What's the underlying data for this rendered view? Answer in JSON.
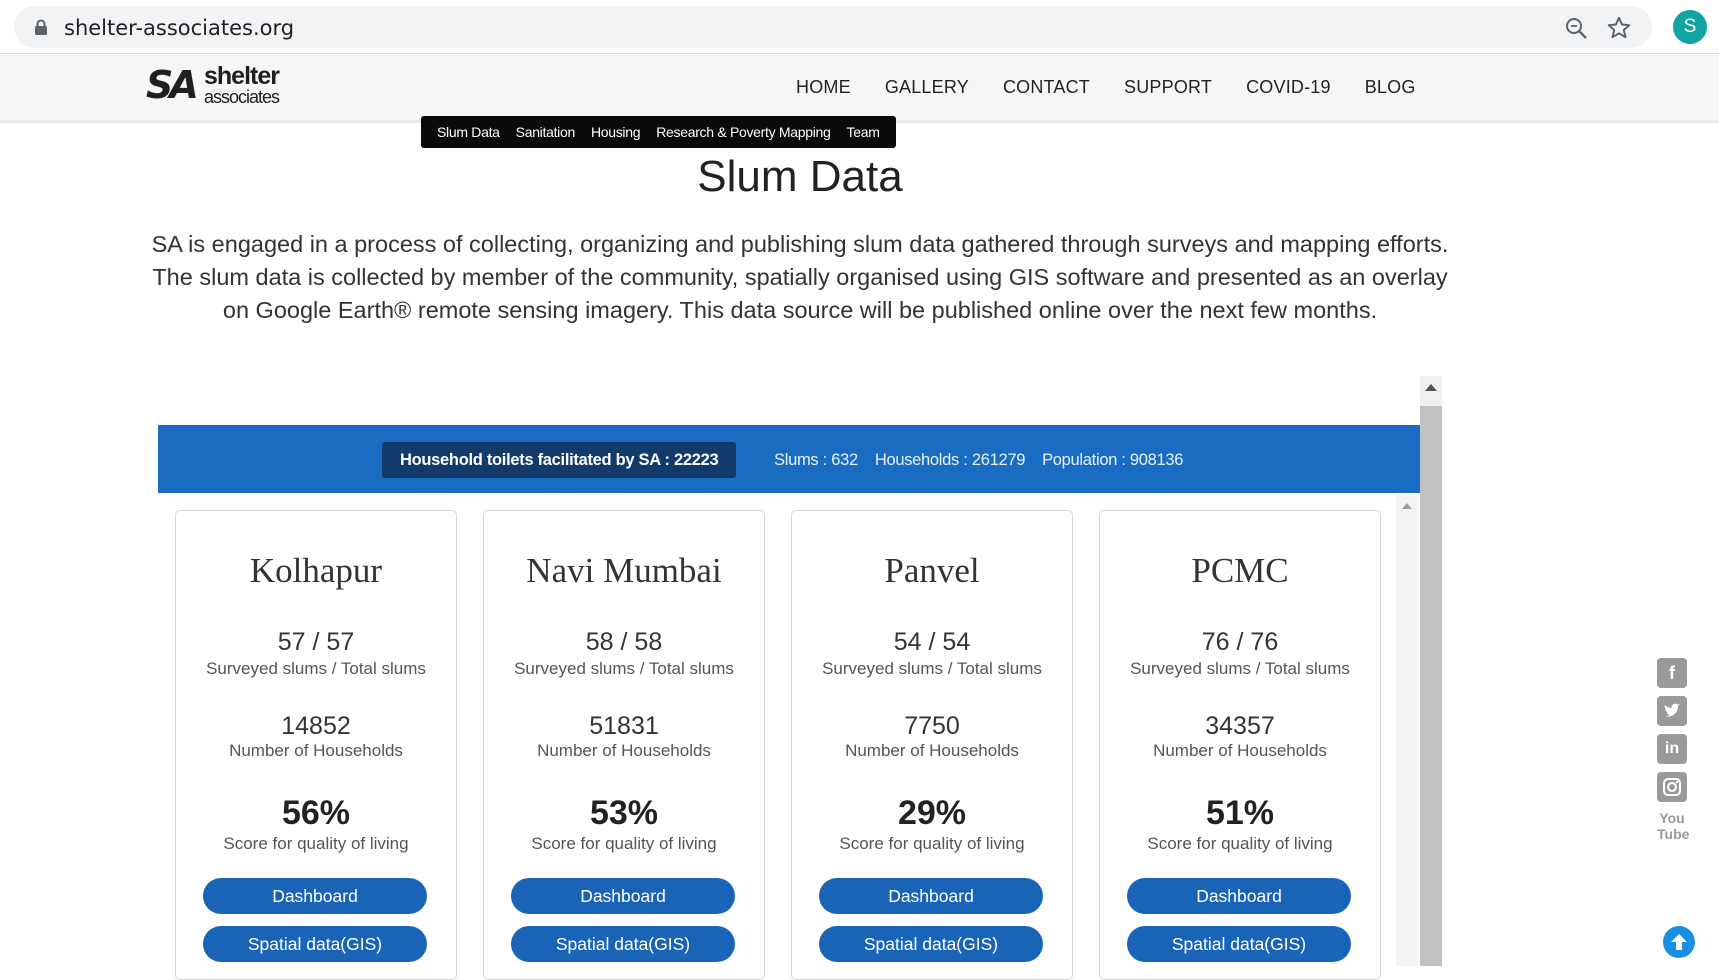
{
  "browser": {
    "url": "shelter-associates.org",
    "profile_initial": "S"
  },
  "header": {
    "logo": {
      "mark": "SA",
      "word1": "shelter",
      "word2": "associates"
    },
    "nav": [
      "HOME",
      "GALLERY",
      "CONTACT",
      "SUPPORT",
      "COVID-19",
      "BLOG"
    ],
    "subnav": [
      "Slum Data",
      "Sanitation",
      "Housing",
      "Research & Poverty Mapping",
      "Team"
    ]
  },
  "page": {
    "title": "Slum Data",
    "intro": "SA is engaged in a process of collecting, organizing and publishing slum data gathered through surveys and mapping efforts. The slum data is collected by member of the community, spatially organised using GIS software and presented as an overlay on Google Earth® remote sensing imagery. This data source will be published online over the next few months."
  },
  "stats": {
    "toilets": "Household toilets facilitated by SA : 22223",
    "slums": "Slums : 632",
    "households": "Households : 261279",
    "population": "Population : 908136"
  },
  "cards": [
    {
      "city": "Kolhapur",
      "ratio": "57 / 57",
      "ratio_label": "Surveyed slums / Total slums",
      "households": "14852",
      "households_label": "Number of Households",
      "score": "56%",
      "score_label": "Score for quality of living",
      "dashboard_label": "Dashboard",
      "gis_label": "Spatial data(GIS)"
    },
    {
      "city": "Navi Mumbai",
      "ratio": "58 / 58",
      "ratio_label": "Surveyed slums / Total slums",
      "households": "51831",
      "households_label": "Number of Households",
      "score": "53%",
      "score_label": "Score for quality of living",
      "dashboard_label": "Dashboard",
      "gis_label": "Spatial data(GIS)"
    },
    {
      "city": "Panvel",
      "ratio": "54 / 54",
      "ratio_label": "Surveyed slums / Total slums",
      "households": "7750",
      "households_label": "Number of Households",
      "score": "29%",
      "score_label": "Score for quality of living",
      "dashboard_label": "Dashboard",
      "gis_label": "Spatial data(GIS)"
    },
    {
      "city": "PCMC",
      "ratio": "76 / 76",
      "ratio_label": "Surveyed slums / Total slums",
      "households": "34357",
      "households_label": "Number of Households",
      "score": "51%",
      "score_label": "Score for quality of living",
      "dashboard_label": "Dashboard",
      "gis_label": "Spatial data(GIS)"
    }
  ],
  "social": {
    "icons": [
      "facebook-icon",
      "twitter-icon",
      "linkedin-icon",
      "instagram-icon",
      "youtube-icon"
    ],
    "youtube_top": "You",
    "youtube_bottom": "Tube"
  },
  "colors": {
    "band": "#1a6cc2",
    "pill": "#123b6b",
    "button": "#1a64b8",
    "subnav": "#0a0a0a"
  }
}
